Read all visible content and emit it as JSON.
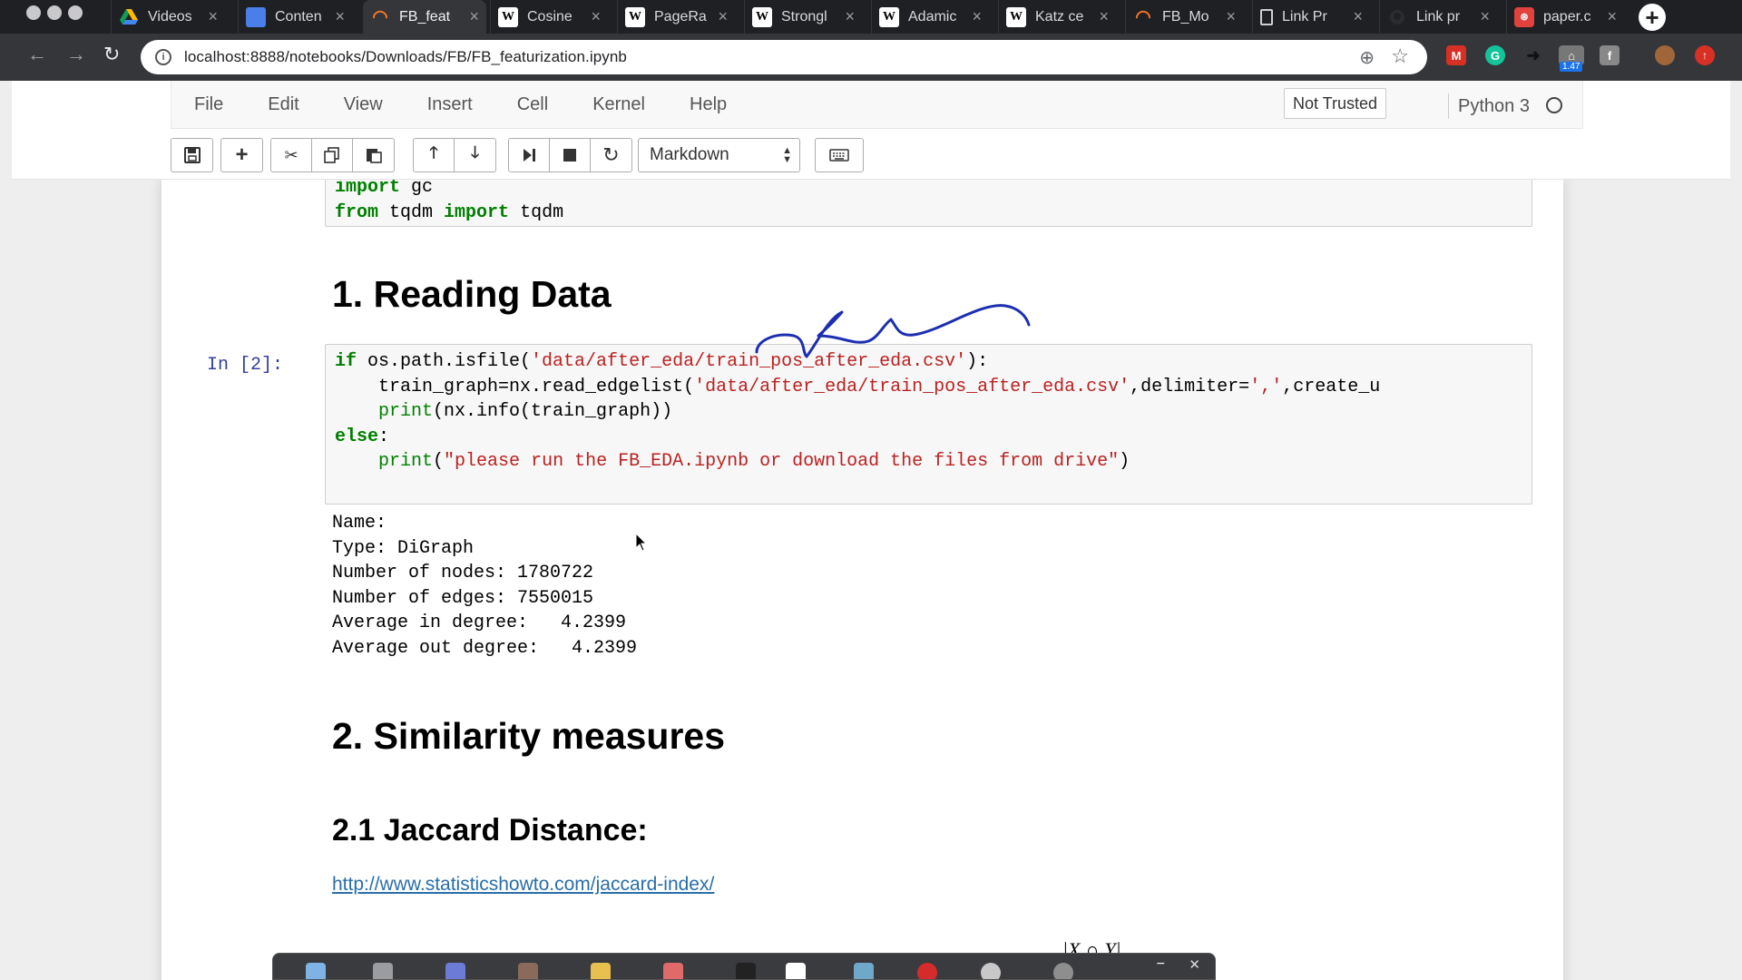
{
  "browser": {
    "tabs": [
      {
        "label": "Videos",
        "icon": "google-drive-icon"
      },
      {
        "label": "Conten",
        "icon": "google-docs-icon"
      },
      {
        "label": "FB_feat",
        "icon": "jupyter-icon",
        "active": true
      },
      {
        "label": "Cosine",
        "icon": "wikipedia-icon"
      },
      {
        "label": "PageRa",
        "icon": "wikipedia-icon"
      },
      {
        "label": "Strongl",
        "icon": "wikipedia-icon"
      },
      {
        "label": "Adamic",
        "icon": "wikipedia-icon"
      },
      {
        "label": "Katz ce",
        "icon": "wikipedia-icon"
      },
      {
        "label": "FB_Mo",
        "icon": "jupyter-icon"
      },
      {
        "label": "Link Pr",
        "icon": "file-icon"
      },
      {
        "label": "Link pr",
        "icon": "github-icon"
      },
      {
        "label": "paper.c",
        "icon": "pdf-icon"
      }
    ],
    "url": "localhost:8888/notebooks/Downloads/FB/FB_featurization.ipynb",
    "extension_badge": "1.47"
  },
  "jupyter": {
    "menu": [
      "File",
      "Edit",
      "View",
      "Insert",
      "Cell",
      "Kernel",
      "Help"
    ],
    "trust_label": "Not Trusted",
    "kernel_name": "Python 3",
    "cell_type_select": "Markdown"
  },
  "notebook": {
    "top_cell_lines": [
      "import gc",
      "from tqdm import tqdm"
    ],
    "heading_reading": "1. Reading Data",
    "cell2_prompt": "In [2]:",
    "cell2_code": {
      "l1_kw": "if",
      "l1_a": " os.path.isfile(",
      "l1_str": "'data/after_eda/train_pos_after_eda.csv'",
      "l1_b": "):",
      "l2_a": "    train_graph=nx.read_edgelist(",
      "l2_str": "'data/after_eda/train_pos_after_eda.csv'",
      "l2_b": ",delimiter=",
      "l2_str2": "','",
      "l2_c": ",create_u",
      "l3_bi": "print",
      "l3_a": "(nx.info(train_graph))",
      "l4_kw": "else",
      "l4_a": ":",
      "l5_bi": "print",
      "l5_a": "(",
      "l5_str": "\"please run the FB_EDA.ipynb or download the files from drive\"",
      "l5_b": ")"
    },
    "output_lines": [
      "Name:",
      "Type: DiGraph",
      "Number of nodes: 1780722",
      "Number of edges: 7550015",
      "Average in degree:   4.2399",
      "Average out degree:   4.2399"
    ],
    "heading_similarity": "2. Similarity measures",
    "heading_jaccard": "2.1 Jaccard Distance:",
    "jaccard_link": "http://www.statisticshowto.com/jaccard-index/",
    "math_fragment": "|X ∩ Y|"
  },
  "colors": {
    "annotation_ink": "#1d2fb0",
    "prompt_in": "#303f9f",
    "keyword": "#008000",
    "string": "#ba2121",
    "link": "#296eaa"
  }
}
